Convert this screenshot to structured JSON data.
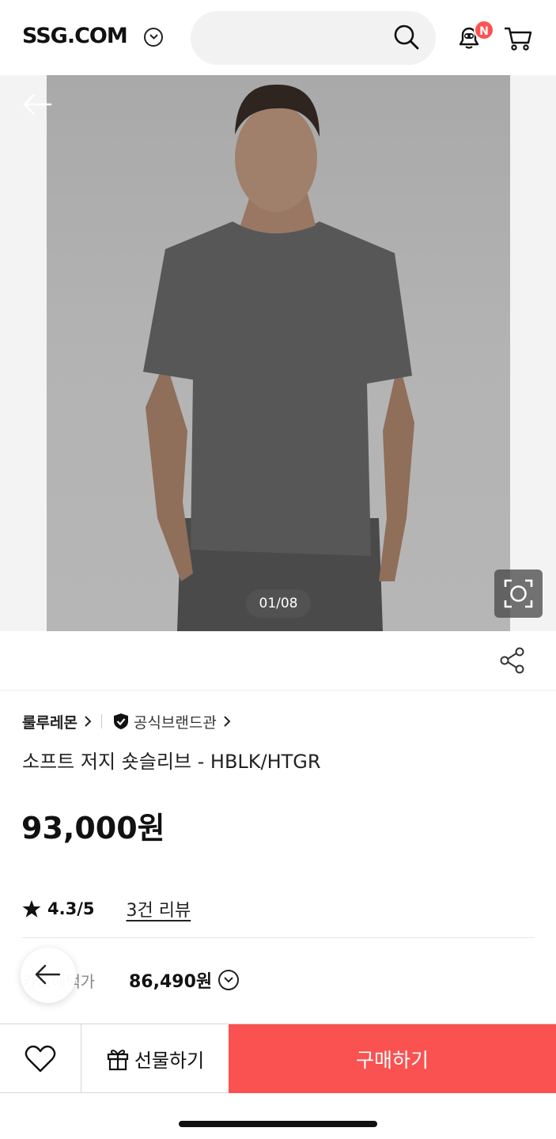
{
  "header": {
    "logo": "SSG.COM",
    "notification_badge": "N"
  },
  "hero": {
    "image_counter": "01/08"
  },
  "product": {
    "brand": "룰루레몬",
    "official_store": "공식브랜드관",
    "name": "소프트 저지 숏슬리브 - HBLK/HTGR",
    "price": "93,000원",
    "rating": "4.3/5",
    "reviews": "3건 리뷰",
    "card_price_label": "카드혜택가",
    "card_price": "86,490원"
  },
  "bottom_bar": {
    "gift_label": "선물하기",
    "buy_label": "구매하기"
  },
  "colors": {
    "buy_button": "#fa5151",
    "badge": "#ff5252"
  },
  "icons": [
    "chevron-down-icon",
    "search-icon",
    "bell-icon",
    "cart-icon",
    "back-arrow-icon",
    "lens-icon",
    "share-icon",
    "verified-shield-icon",
    "star-icon",
    "heart-icon",
    "gift-icon"
  ]
}
